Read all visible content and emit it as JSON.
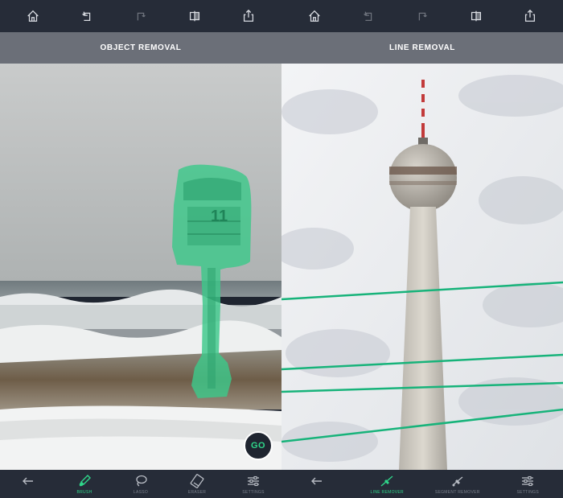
{
  "left": {
    "title": "OBJECT REMOVAL",
    "go_label": "GO",
    "tools": [
      {
        "icon": "back-arrow-icon",
        "label": ""
      },
      {
        "icon": "brush-icon",
        "label": "BRUSH",
        "active": true
      },
      {
        "icon": "lasso-icon",
        "label": "LASSO"
      },
      {
        "icon": "eraser-icon",
        "label": "ERASER"
      },
      {
        "icon": "sliders-icon",
        "label": "SETTINGS"
      }
    ]
  },
  "right": {
    "title": "LINE REMOVAL",
    "tools": [
      {
        "icon": "back-arrow-icon",
        "label": ""
      },
      {
        "icon": "line-remover-icon",
        "label": "LINE REMOVER",
        "active": true
      },
      {
        "icon": "segment-remover-icon",
        "label": "SEGMENT REMOVER"
      },
      {
        "icon": "sliders-icon",
        "label": "SETTINGS"
      }
    ]
  },
  "topbar_icons": [
    "home-icon",
    "undo-icon",
    "redo-icon",
    "compare-icon",
    "share-icon"
  ],
  "colors": {
    "bar_background": "#262c38",
    "title_background": "#6b6f78",
    "accent_green": "#2fd68a",
    "mask_green": "#3dc88a"
  }
}
